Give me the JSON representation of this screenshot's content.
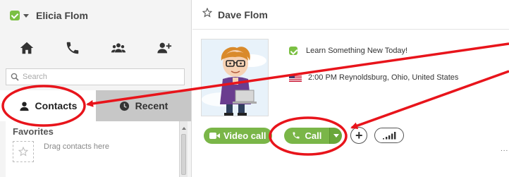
{
  "colors": {
    "accent_green": "#7ab648",
    "annotation_red": "#e8141b",
    "recent_tab_bg": "#c7c7c7"
  },
  "user": {
    "name": "Elicia Flom",
    "status_icon": "online-check-icon"
  },
  "actions": [
    {
      "name": "home",
      "icon": "home-icon"
    },
    {
      "name": "call-phones",
      "icon": "phone-icon"
    },
    {
      "name": "create-group",
      "icon": "group-icon"
    },
    {
      "name": "add-contact",
      "icon": "add-contact-icon"
    }
  ],
  "search": {
    "placeholder": "Search",
    "value": ""
  },
  "tabs": [
    {
      "label": "Contacts",
      "icon": "person-icon",
      "selected": true
    },
    {
      "label": "Recent",
      "icon": "clock-icon",
      "selected": false
    }
  ],
  "favorites": {
    "heading": "Favorites",
    "hint": "Drag contacts here"
  },
  "contact": {
    "name": "Dave Flom",
    "mood": "Learn Something New Today!",
    "location": "2:00 PM Reynoldsburg, Ohio, United States"
  },
  "call_bar": {
    "video_call_label": "Video call",
    "call_label": "Call",
    "add_symbol": "+",
    "more": "..."
  }
}
